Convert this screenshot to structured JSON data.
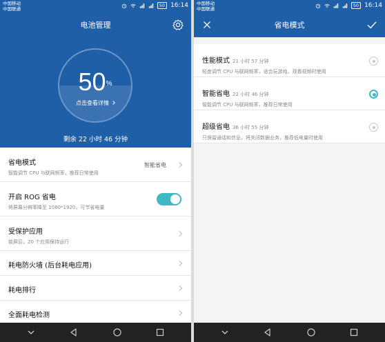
{
  "status": {
    "carrier1": "中国移动",
    "carrier2": "中国联通",
    "battery": "50",
    "time": "16:14"
  },
  "left": {
    "title": "电池管理",
    "percent": "50",
    "percent_unit": "%",
    "detail_link": "点击查看详情",
    "remaining": "剩余 22 小时 46 分钟",
    "rows": [
      {
        "title": "省电模式",
        "sub": "智能调节 CPU 与联网频率，推荐日常使用",
        "value": "智能省电"
      },
      {
        "title": "开启 ROG 省电",
        "sub": "将屏幕分辨率降至 1080*1920，可节省电量",
        "toggle_on": true
      },
      {
        "title": "受保护应用",
        "sub": "锁屏后，20 个应用保持运行"
      },
      {
        "title": "耗电防火墙 (后台耗电应用)"
      },
      {
        "title": "耗电排行"
      },
      {
        "title": "全面耗电检测"
      }
    ]
  },
  "right": {
    "title": "省电模式",
    "selected_index": 1,
    "options": [
      {
        "title": "性能模式",
        "time": "21 小时 57 分钟",
        "desc": "轻度调节 CPU 与联网频率，适合玩游戏、观看视频时使用"
      },
      {
        "title": "智能省电",
        "time": "22 小时 46 分钟",
        "desc": "智能调节 CPU 与联网频率，推荐日常使用"
      },
      {
        "title": "超级省电",
        "time": "36 小时 55 分钟",
        "desc": "只保留通话和信息，将关闭数据业务，推荐低电量时使用"
      }
    ]
  },
  "colors": {
    "header_blue": "#1f5fa8",
    "accent_teal": "#3fb8c4",
    "navbar": "#222222"
  },
  "icons": [
    "settings-gear-icon",
    "close-icon",
    "check-icon",
    "chevron-right-icon",
    "nav-collapse-icon",
    "nav-back-icon",
    "nav-home-icon",
    "nav-recents-icon"
  ]
}
